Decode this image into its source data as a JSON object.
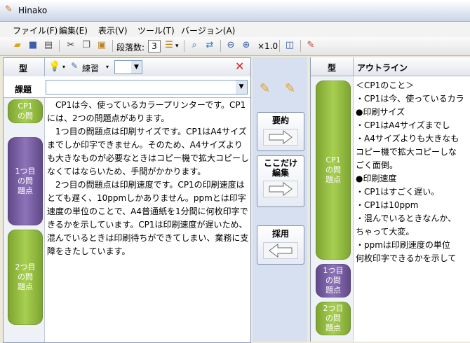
{
  "window": {
    "title": "Hinako"
  },
  "menu": [
    "ファイル(F)",
    "編集(E)",
    "表示(V)",
    "ツール(T)",
    "バージョン(A)"
  ],
  "toolbar": {
    "paragraph_label": "段落数:",
    "paragraph_value": "3",
    "zoom_label": "×1.0"
  },
  "left_panel": {
    "type_header": "型",
    "practice_label": "練習",
    "task_label": "課題",
    "tags": [
      "CP1\nの問",
      "1つ目\nの問\n題点",
      "2つ目\nの問\n題点"
    ],
    "body_text": "　CP1は今、使っているカラープリンターです。CP1には、2つの問題点があります。\n　1つ目の問題点は印刷サイズです。CP1はA4サイズまでしか印字できません。そのため、A4サイズよりも大きなものが必要なときはコピー機で拡大コピーしなくてはならいため、手間がかかります。\n　2つ目の問題点は印刷速度です。CP1の印刷速度はとても遅く、10ppmしかありません。ppmとは印字速度の単位のことで、A4普通紙を1分間に何枚印字できるかを示しています。CP1は印刷速度が遅いため、混んでいるときは印刷待ちができてしまい、業務に支障をきたしています。"
  },
  "middle_panel": {
    "buttons": [
      "要約",
      "ここだけ\n編集",
      "採用"
    ]
  },
  "right_panel": {
    "type_header": "型",
    "outline_header": "アウトライン",
    "tags": [
      "CP1\nの問\n題点",
      "1つ目\nの問\n題点",
      "2つ目\nの問\n題点"
    ],
    "outline_lines": [
      "＜CP1のこと＞",
      "・CP1は今、使っているカラ",
      "●印刷サイズ",
      "・CP1はA4サイズまでし",
      "・A4サイズよりも大きなも",
      "コピー機で拡大コピーしな",
      "ごく面倒。",
      "●印刷速度",
      "・CP1はすごく遅い。",
      "・CP1は10ppm",
      "・混んでいるときなんか、",
      "ちゃって大変。",
      "・ppmは印刷速度の単位",
      "何枚印字できるかを示して"
    ]
  }
}
